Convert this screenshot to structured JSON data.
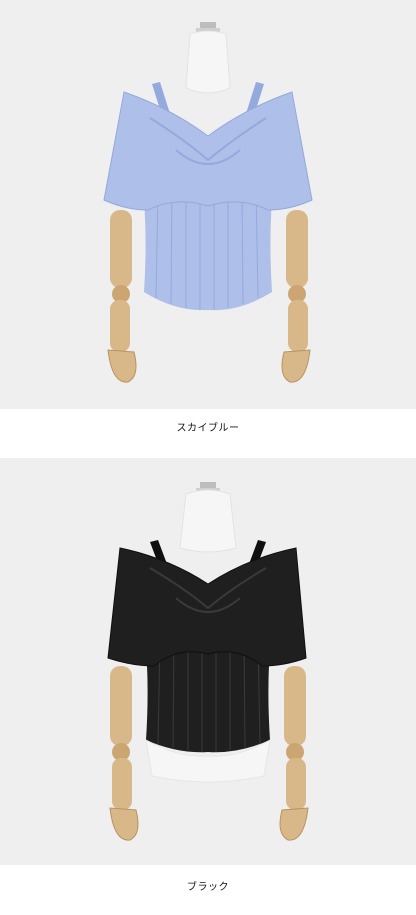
{
  "products": [
    {
      "color_name": "スカイブルー",
      "garment_color": "#aebfe9",
      "garment_shade": "#94a9dc"
    },
    {
      "color_name": "ブラック",
      "garment_color": "#1f1f1f",
      "garment_shade": "#0f0f0f"
    }
  ],
  "colors": {
    "background": "#efefef",
    "mannequin_wood": "#d8b889",
    "mannequin_body": "#f6f6f6"
  }
}
